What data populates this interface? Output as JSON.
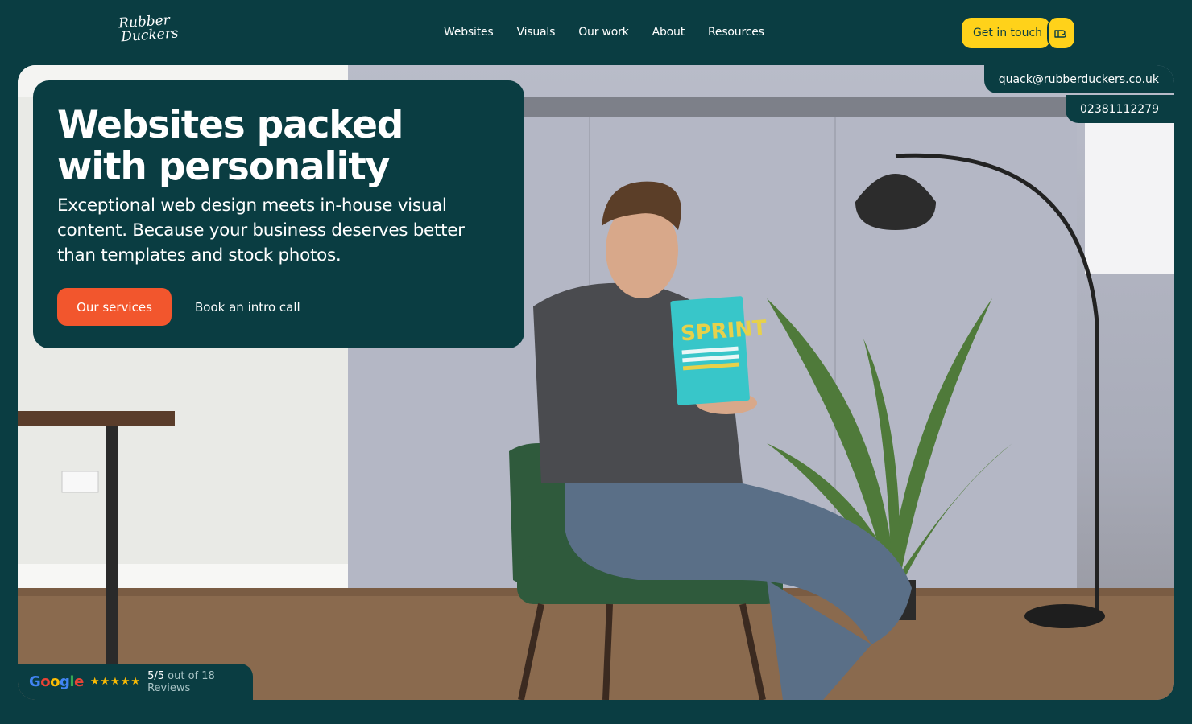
{
  "brand": {
    "logo_line1": "Rubber",
    "logo_line2": "Duckers"
  },
  "nav": {
    "items": [
      "Websites",
      "Visuals",
      "Our work",
      "About",
      "Resources"
    ]
  },
  "cta": {
    "label": "Get in touch",
    "icon": "pointing-hand-icon"
  },
  "contact": {
    "email": "quack@rubberduckers.co.uk",
    "phone": "02381112279"
  },
  "hero": {
    "title": "Websites packed with personality",
    "subtitle": "Exceptional web design meets in-house visual content. Because your business deserves better than templates and stock photos.",
    "primary_button": "Our services",
    "secondary_link": "Book an intro call",
    "book_title": "SPRINT"
  },
  "reviews": {
    "provider": "Google",
    "stars": "★★★★★",
    "score": "5/5",
    "count_text": "out of 18 Reviews"
  },
  "colors": {
    "background": "#0a3d42",
    "accent_yellow": "#ffd21a",
    "accent_orange": "#f2562d"
  }
}
